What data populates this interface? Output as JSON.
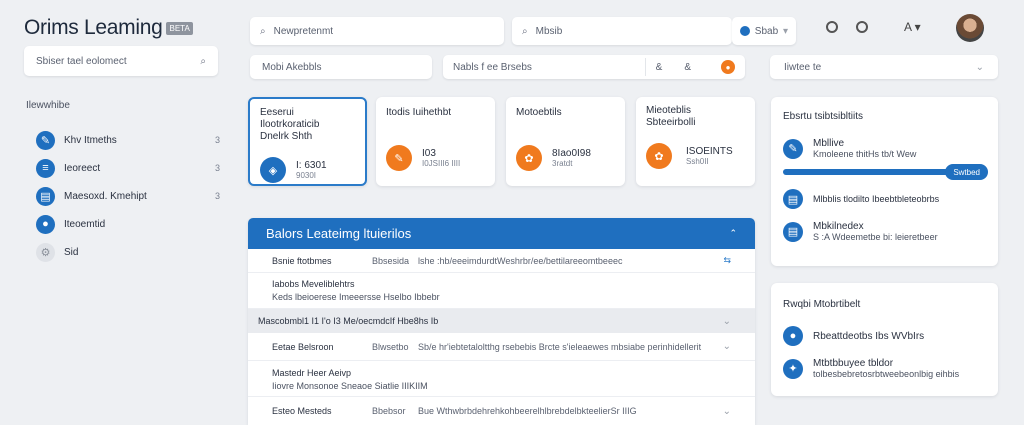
{
  "app": {
    "title": "Orims Leaming",
    "badge": "BETA"
  },
  "sidebar": {
    "search_placeholder": "Sbiser tael eolomect",
    "section_title": "Ilewwhibe",
    "items": [
      {
        "label": "Khv Itmeths",
        "count": "3"
      },
      {
        "label": "Ieoreect",
        "count": "3"
      },
      {
        "label": "Maesoxd. Kmehipt",
        "count": "3"
      },
      {
        "label": "Iteoemtid",
        "count": ""
      },
      {
        "label": "Sid",
        "count": ""
      }
    ]
  },
  "topbar": {
    "search_placeholder": "Newpretenmt",
    "search2_value": "Mbsib",
    "lang_value": "Sbab"
  },
  "filterbar": {
    "filter1": "Mobi Akebbls",
    "filter2": "Nabls f ee Brsebs",
    "filter2_icons": [
      "&",
      "&"
    ],
    "right_filter": "Iiwtee te"
  },
  "stat_cards": [
    {
      "title": "Eeserui Ilootrkoraticib",
      "subtitle": "Dnelrk Shth",
      "value": "I: 6301",
      "sub": "9030I",
      "icon": "book-icon"
    },
    {
      "title": "Itodis Iuihethbt",
      "subtitle": "",
      "value": "I03",
      "sub": "I0JSIII6 IIII",
      "icon": "pen-icon"
    },
    {
      "title": "Motoebtils",
      "subtitle": "",
      "value": "8Iao0I98",
      "sub": "3ratdt",
      "icon": "group-icon"
    },
    {
      "title": "Mieoteblis",
      "subtitle": "Sbteeirbolli",
      "value": "ISOEINTS",
      "sub": "Ssh0II",
      "icon": "group-icon"
    }
  ],
  "course_table": {
    "title": "Balors Leateimg ltuierilos",
    "rows": [
      {
        "type": "row",
        "name": "Bsnie ftotbmes",
        "tag": "Bbsesida",
        "desc": "lshe :hb/eeeimdurdtWeshrbr/ee/bettilareeomtbeeec"
      },
      {
        "type": "sub",
        "title": "Iabobs Meveliblehtrs",
        "text": "Keds lbeioerese Imeeersse Hselbo Ibbebr"
      },
      {
        "type": "group",
        "title": "Mascobmbl1 I1 I'o I3 Me/oecmdcIf Hbe8hs Ib"
      },
      {
        "type": "row",
        "name": "Eetae Belsroon",
        "tag": "Blwsetbo",
        "desc": "Sb/e hr'iebtetaloltthg rsebebis Brcte s'ieleaewes mbsiabe perinhidellerit"
      },
      {
        "type": "sub",
        "title": "Mastedr Heer Aeivp",
        "text": "Iiovre Monsonoe Sneaoe Siatlie IIIKIIM"
      },
      {
        "type": "row",
        "name": "Esteo Mesteds",
        "tag": "Bbebsor",
        "desc": "Bue WthwbrbdehrehkohbeerelhlbrebdelbkteelierSr IIIG"
      }
    ]
  },
  "progress_card": {
    "title": "Ebsrtu tsibtsibltiits",
    "item1_title": "Mbllive",
    "item1_sub": "Kmoleene thitHs tb/t Wew",
    "progress": 0.88,
    "progress_label": "Swtbed",
    "item2": "Mlbblis tlodilto Ibeebtbleteobrbs",
    "item3_title": "Mbkilnedex",
    "item3_sub": "S :A Wdeemetbe bi: leieretbeer"
  },
  "activity_card": {
    "title": "Rwqbi Mtobrtibelt",
    "item1": "Rbeattdeotbs Ibs WVbIrs",
    "item2_title": "Mtbtbbuyee tbldor",
    "item2_sub": "tolbesbebretosrbtweebeonlbig eihbis"
  },
  "colors": {
    "accent": "#1f6fbf",
    "orange": "#f07a1e"
  }
}
